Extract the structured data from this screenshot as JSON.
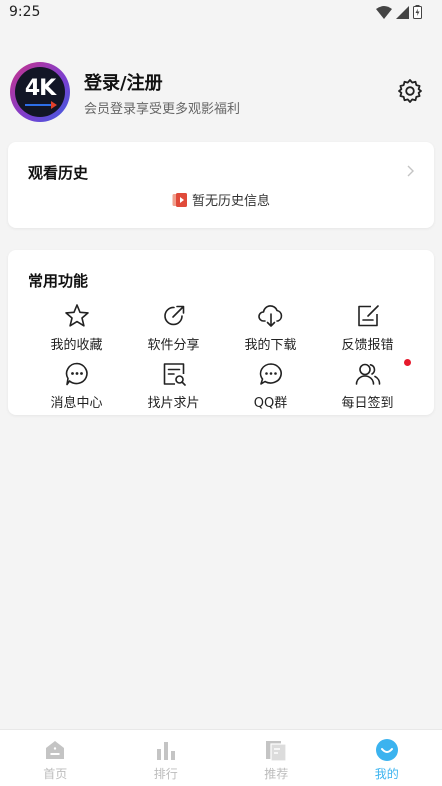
{
  "status": {
    "time": "9:25"
  },
  "profile": {
    "avatar_text": "4K",
    "login_label": "登录/注册",
    "login_subtitle": "会员登录享受更多观影福利"
  },
  "history": {
    "title": "观看历史",
    "empty_text": "暂无历史信息"
  },
  "functions": {
    "title": "常用功能",
    "items": [
      {
        "label": "我的收藏",
        "icon": "star-icon"
      },
      {
        "label": "软件分享",
        "icon": "share-icon"
      },
      {
        "label": "我的下载",
        "icon": "cloud-download-icon"
      },
      {
        "label": "反馈报错",
        "icon": "edit-note-icon"
      },
      {
        "label": "消息中心",
        "icon": "message-icon"
      },
      {
        "label": "找片求片",
        "icon": "search-document-icon"
      },
      {
        "label": "QQ群",
        "icon": "chat-bubbles-icon"
      },
      {
        "label": "每日签到",
        "icon": "users-icon"
      }
    ]
  },
  "nav": {
    "items": [
      {
        "label": "首页",
        "icon": "home-icon"
      },
      {
        "label": "排行",
        "icon": "bar-chart-icon"
      },
      {
        "label": "推荐",
        "icon": "pages-icon"
      },
      {
        "label": "我的",
        "icon": "smile-face-icon"
      }
    ],
    "active": "我的"
  },
  "colors": {
    "accent": "#3bb3ef",
    "inactive": "#bcbcbc",
    "badge": "#e6192c",
    "background": "#f4f4f4"
  }
}
